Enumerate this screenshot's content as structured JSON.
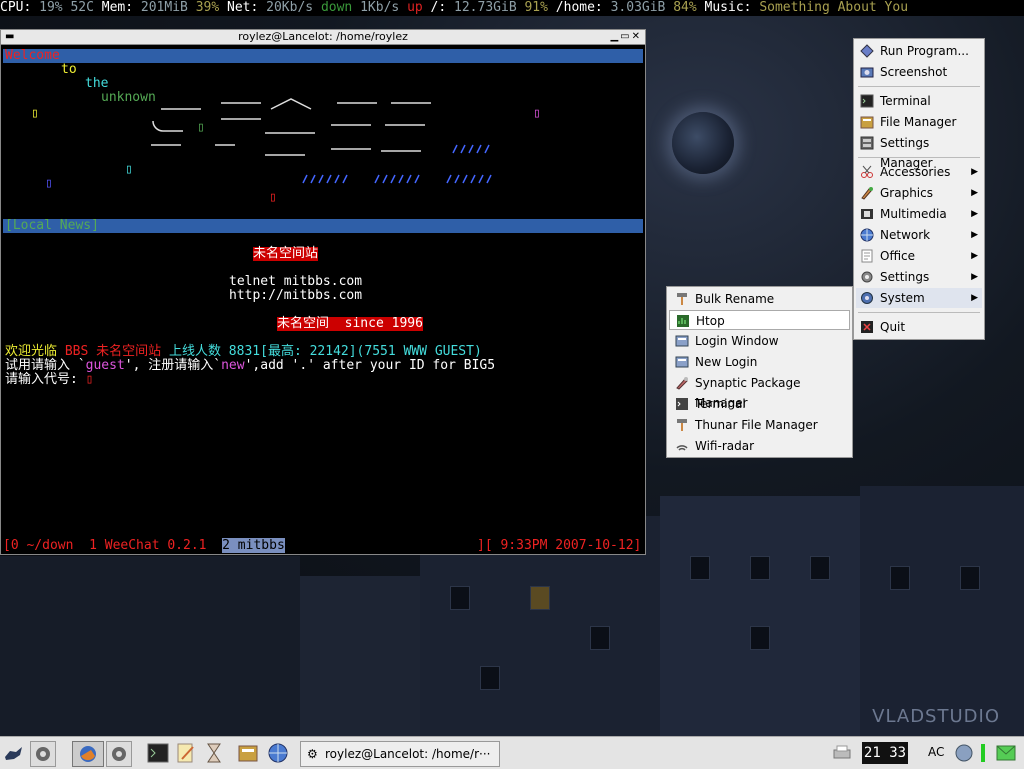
{
  "statusbar": {
    "cpu_label": "CPU:",
    "cpu_pct": "19%",
    "cpu_temp": "52C",
    "mem_label": "Mem:",
    "mem_val": "201MiB",
    "mem_pct": "39%",
    "net_label": "Net:",
    "net_down": "20Kb/s",
    "down": "down",
    "net_up": "1Kb/s",
    "up": "up",
    "root_label": "/:",
    "root_val": "12.73GiB",
    "root_pct": "91%",
    "home_label": "/home:",
    "home_val": "3.03GiB",
    "home_pct": "84%",
    "music_label": "Music:",
    "music_val": "Something About You"
  },
  "terminal": {
    "title": "roylez@Lancelot: /home/roylez",
    "welcome": "Welcome",
    "to": "to",
    "the": "the",
    "unknown": "unknown",
    "local_news": "[Local News]",
    "station_name": "未名空间站",
    "telnet": "telnet mitbbs.com",
    "http": "http://mitbbs.com",
    "since": "未名空间  since 1996",
    "welcome_line_1": "欢迎光临",
    "welcome_line_2": "BBS 未名空间站",
    "welcome_line_3": "上线人数 8831[最高: 22142](7551 WWW GUEST)",
    "try_line_a": "试用请输入 `",
    "try_guest": "guest",
    "try_line_b": "', 注册请输入`",
    "try_new": "new",
    "try_line_c": "',add '.' after your ID for BIG5",
    "prompt": "请输入代号:",
    "status_left": "[0 ~/down  1 WeeChat 0.2.1  ",
    "status_sel": "2 mitbbs",
    "status_right": "][ 9:33PM 2007-10-12]"
  },
  "main_menu": {
    "items": [
      {
        "label": "Run Program...",
        "icon": "run-icon"
      },
      {
        "label": "Screenshot",
        "icon": "camera-icon"
      },
      {
        "label": "Terminal",
        "icon": "terminal-icon"
      },
      {
        "label": "File Manager",
        "icon": "folder-icon"
      },
      {
        "label": "Settings Manager",
        "icon": "settings-icon"
      },
      {
        "label": "Accessories",
        "icon": "scissors-icon"
      },
      {
        "label": "Graphics",
        "icon": "paint-icon"
      },
      {
        "label": "Multimedia",
        "icon": "film-icon"
      },
      {
        "label": "Network",
        "icon": "globe-icon"
      },
      {
        "label": "Office",
        "icon": "document-icon"
      },
      {
        "label": "Settings",
        "icon": "gear-icon"
      },
      {
        "label": "System",
        "icon": "system-icon"
      },
      {
        "label": "Quit",
        "icon": "quit-icon"
      }
    ]
  },
  "system_menu": {
    "items": [
      {
        "label": "Bulk Rename",
        "icon": "brush-icon"
      },
      {
        "label": "Htop",
        "icon": "htop-icon"
      },
      {
        "label": "Login Window",
        "icon": "login-icon"
      },
      {
        "label": "New Login",
        "icon": "login-icon"
      },
      {
        "label": "Synaptic Package Manager",
        "icon": "package-icon"
      },
      {
        "label": "Terminal",
        "icon": "terminal-icon"
      },
      {
        "label": "Thunar File Manager",
        "icon": "brush-icon"
      },
      {
        "label": "Wifi-radar",
        "icon": "wifi-icon"
      }
    ]
  },
  "taskbar": {
    "task_title": "roylez@Lancelot: /home/r···",
    "clock": "21 33",
    "ac": "AC"
  },
  "wallpaper": {
    "watermark": "VLADSTUDIO"
  }
}
